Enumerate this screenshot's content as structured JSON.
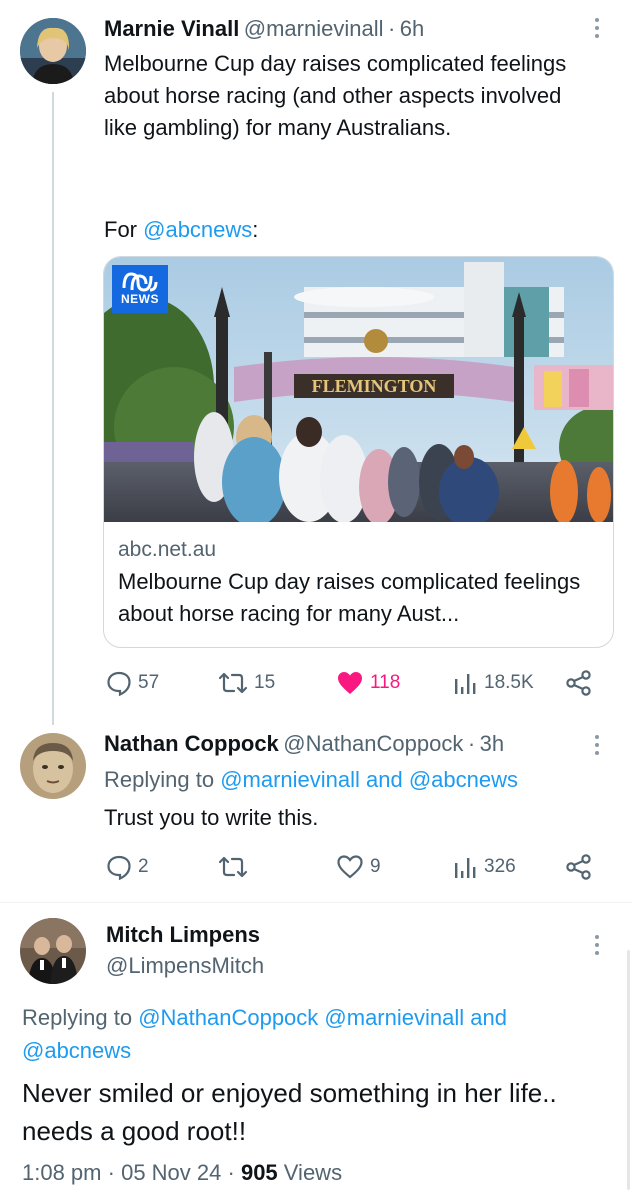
{
  "tweet1": {
    "name": "Marnie Vinall",
    "handle": "@marnievinall",
    "dot": "·",
    "time": "6h",
    "text": "Melbourne Cup day raises complicated feelings about horse racing (and other aspects involved like gambling) for many Australians.",
    "for_prefix": "For ",
    "for_mention": "@abcnews",
    "for_suffix": ":",
    "card": {
      "logo_text": "NEWS",
      "sign_text": "FLEMINGTON",
      "domain": "abc.net.au",
      "title": "Melbourne Cup day raises complicated feelings about horse racing for many Aust..."
    },
    "actions": {
      "replies": "57",
      "reposts": "15",
      "likes": "118",
      "views": "18.5K"
    },
    "like_color": "#f91880"
  },
  "tweet2": {
    "name": "Nathan Coppock",
    "handle": "@NathanCoppock",
    "dot": "·",
    "time": "3h",
    "replying_prefix": "Replying to ",
    "replying_mentions": "@marnievinall and @abcnews",
    "text": "Trust you to write this.",
    "actions": {
      "replies": "2",
      "reposts": "",
      "likes": "9",
      "views": "326"
    }
  },
  "tweet3": {
    "name": "Mitch Limpens",
    "handle": "@LimpensMitch",
    "replying_prefix": "Replying to ",
    "replying_line1": "@NathanCoppock @marnievinall and",
    "replying_line2": "@abcnews",
    "text": "Never smiled or enjoyed something in her life.. needs a good root!!",
    "time": "1:08 pm",
    "dot1": "·",
    "date": "05 Nov 24",
    "dot2": "·",
    "views_count": "905",
    "views_label": " Views"
  },
  "colors": {
    "accent": "#1d9bf0",
    "muted": "#536471",
    "border": "#cfd9de"
  }
}
